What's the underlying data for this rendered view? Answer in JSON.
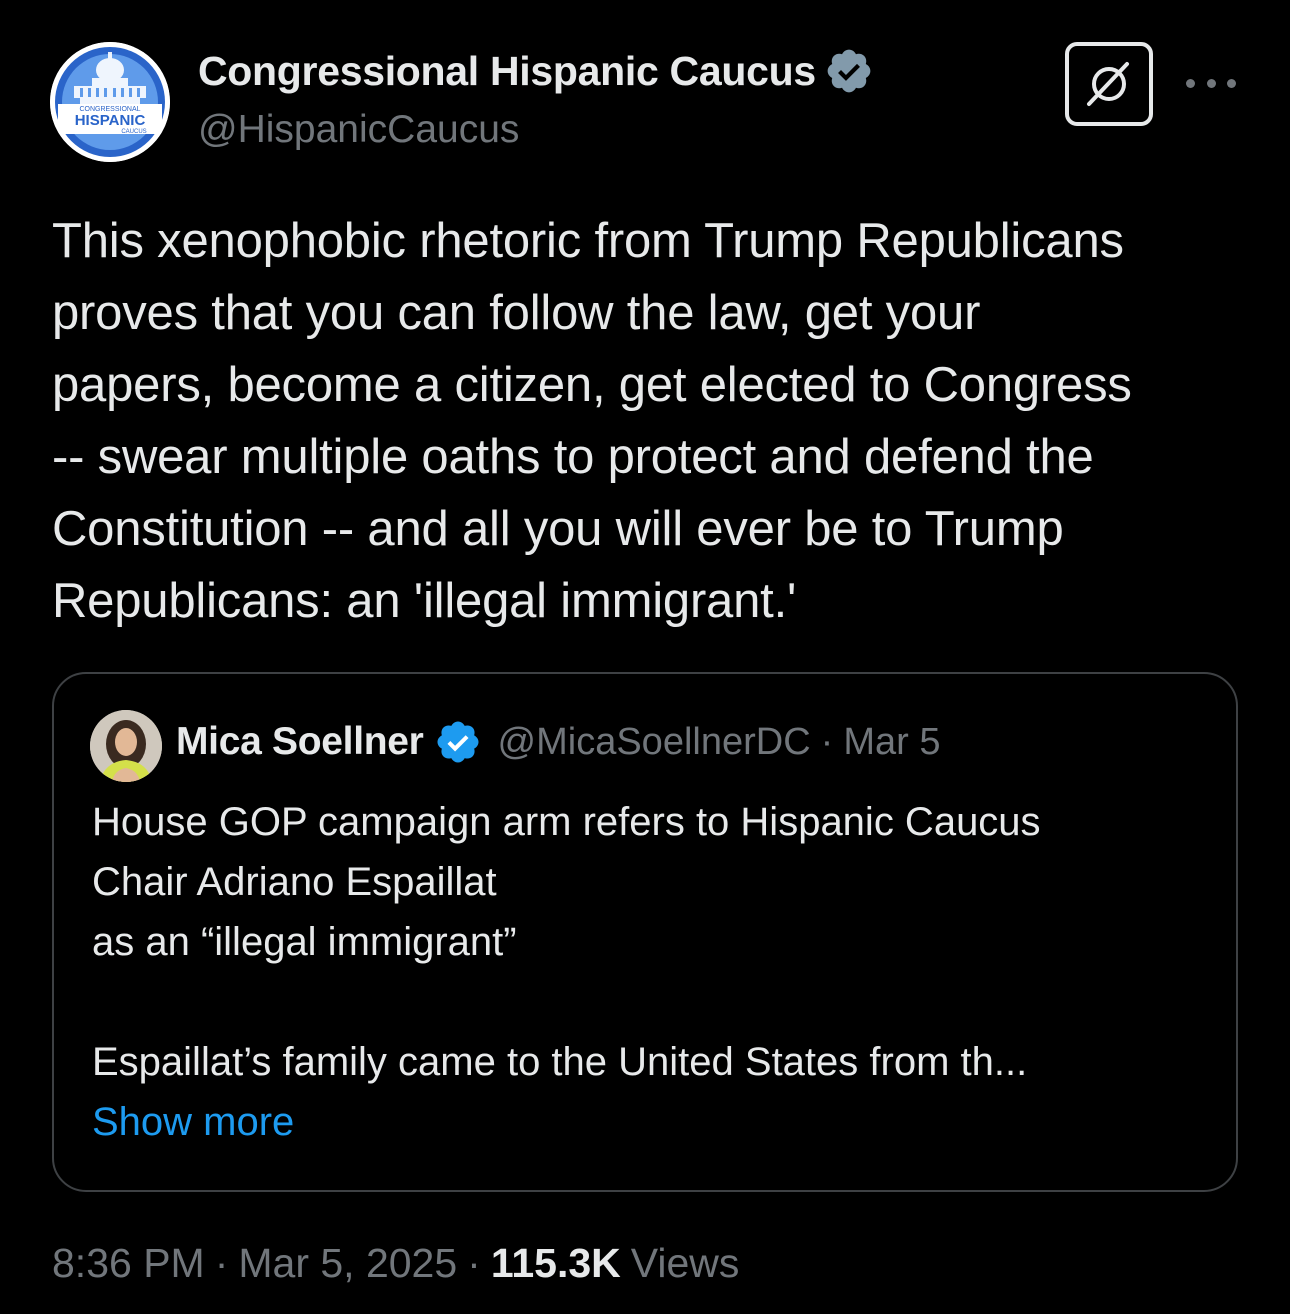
{
  "post": {
    "author_name": "Congressional Hispanic Caucus",
    "author_handle": "@HispanicCaucus",
    "avatar": {
      "line1": "CONGRESSIONAL",
      "line2": "HISPANIC",
      "line3": "CAUCUS"
    },
    "verified_badge": "gray-verified-badge-icon",
    "text": "This xenophobic rhetoric from Trump Republicans\nproves that you can follow the law, get your\npapers, become a citizen, get elected to Congress\n-- swear multiple oaths to protect and defend the\nConstitution -- and all you will ever be to Trump\nRepublicans: an 'illegal immigrant.'",
    "time": "8:36 PM",
    "separator": "·",
    "date": "Mar 5, 2025",
    "views_count": "115.3K",
    "views_label": "Views"
  },
  "quote": {
    "author_name": "Mica Soellner",
    "author_handle": "@MicaSoellnerDC",
    "separator": "·",
    "date": "Mar 5",
    "verified_badge": "blue-verified-badge-icon",
    "lines": [
      "House GOP campaign arm refers to Hispanic Caucus",
      "Chair Adriano Espaillat",
      "as an “illegal immigrant”"
    ],
    "truncated_line": "Espaillat’s family came to the United States from th...",
    "show_more_label": "Show more"
  },
  "icons": {
    "grok": "grok-icon",
    "more": "more-options-icon"
  },
  "colors": {
    "background": "#000000",
    "primary_text": "#e7e9ea",
    "secondary_text": "#71767b",
    "link": "#1d9bf0",
    "border": "#3e4144",
    "verified_blue": "#1d9bf0",
    "verified_gray": "#829aab"
  }
}
